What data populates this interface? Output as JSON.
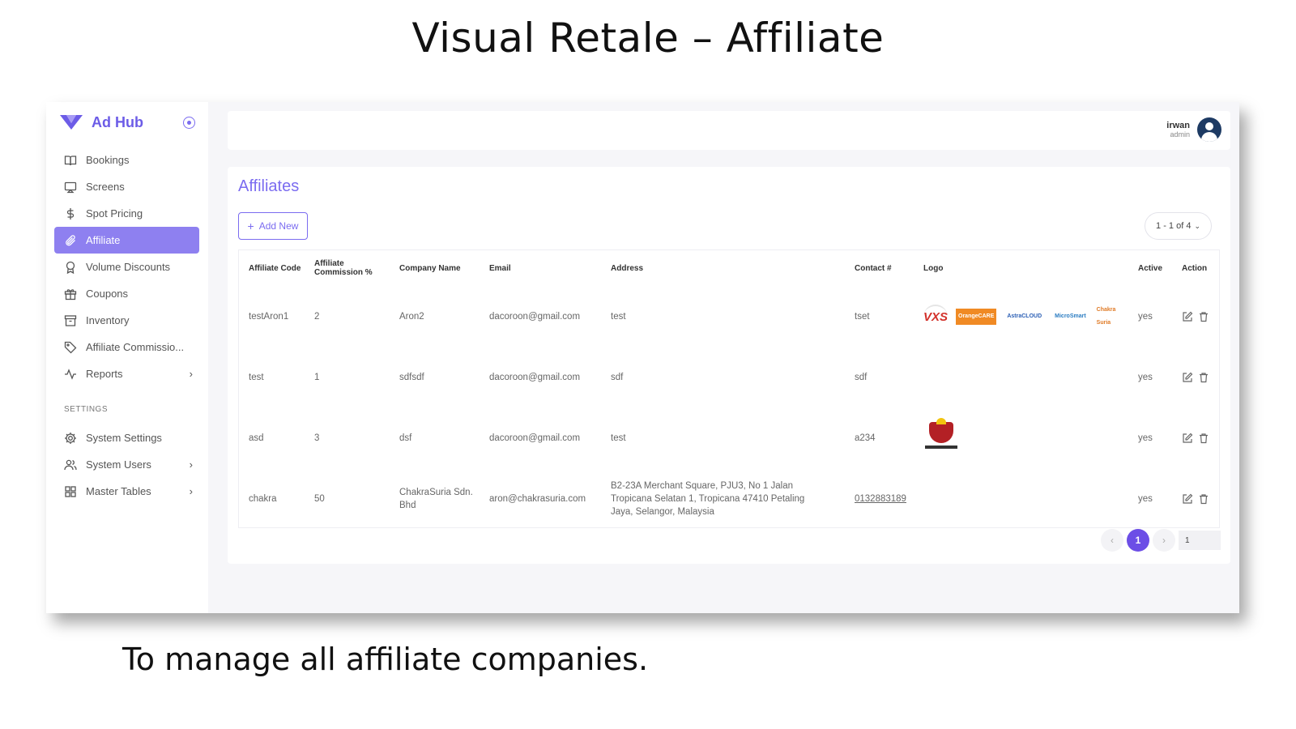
{
  "slide": {
    "title": "Visual Retale – Affiliate",
    "caption": "To manage all affiliate companies."
  },
  "brand": {
    "name": "Ad Hub",
    "accent": "#6c5ce7"
  },
  "sidebar": {
    "items": [
      {
        "label": "Bookings",
        "icon": "book-icon"
      },
      {
        "label": "Screens",
        "icon": "screen-icon"
      },
      {
        "label": "Spot Pricing",
        "icon": "dollar-icon"
      },
      {
        "label": "Affiliate",
        "icon": "paperclip-icon",
        "active": true
      },
      {
        "label": "Volume Discounts",
        "icon": "award-icon"
      },
      {
        "label": "Coupons",
        "icon": "gift-icon"
      },
      {
        "label": "Inventory",
        "icon": "archive-icon"
      },
      {
        "label": "Affiliate Commissio...",
        "icon": "tag-icon"
      },
      {
        "label": "Reports",
        "icon": "activity-icon",
        "has_children": true
      }
    ],
    "settings_heading": "SETTINGS",
    "settings_items": [
      {
        "label": "System Settings",
        "icon": "gear-icon"
      },
      {
        "label": "System Users",
        "icon": "users-icon",
        "has_children": true
      },
      {
        "label": "Master Tables",
        "icon": "grid-icon",
        "has_children": true
      }
    ]
  },
  "header": {
    "user_name": "irwan",
    "user_role": "admin"
  },
  "main": {
    "title": "Affiliates",
    "add_button": "Add New",
    "range_label": "1 - 1 of 4",
    "columns": [
      "Affiliate Code",
      "Affiliate Commission %",
      "Company Name",
      "Email",
      "Address",
      "Contact #",
      "Logo",
      "Active",
      "Action"
    ],
    "rows": [
      {
        "code": "testAron1",
        "commission": "2",
        "company": "Aron2",
        "email": "dacoroon@gmail.com",
        "address": "test",
        "contact": "tset",
        "logo": "logos-strip",
        "active": "yes"
      },
      {
        "code": "test",
        "commission": "1",
        "company": "sdfsdf",
        "email": "dacoroon@gmail.com",
        "address": "sdf",
        "contact": "sdf",
        "logo": "",
        "active": "yes"
      },
      {
        "code": "asd",
        "commission": "3",
        "company": "dsf",
        "email": "dacoroon@gmail.com",
        "address": "test",
        "contact": "a234",
        "logo": "crest",
        "active": "yes"
      },
      {
        "code": "chakra",
        "commission": "50",
        "company": "ChakraSuria Sdn. Bhd",
        "email": "aron@chakrasuria.com",
        "address": "B2-23A Merchant Square, PJU3, No 1 Jalan Tropicana Selatan 1, Tropicana 47410 Petaling Jaya, Selangor, Malaysia",
        "contact": "0132883189",
        "logo": "",
        "active": "yes"
      }
    ],
    "logo_texts": {
      "vxs": "VXS",
      "orange": "OrangeCARE",
      "astra": "AstraCLOUD",
      "micro": "MicroSmart",
      "chakra": "Chakra Suria"
    },
    "pagination": {
      "prev": "‹",
      "current": "1",
      "next": "›",
      "page_input": "1"
    }
  }
}
